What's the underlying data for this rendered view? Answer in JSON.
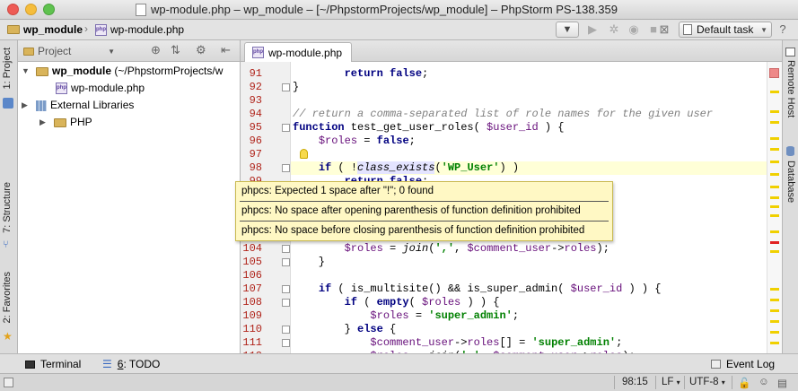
{
  "window": {
    "title": "wp-module.php – wp_module – [~/PhpstormProjects/wp_module] – PhpStorm PS-138.359"
  },
  "navbar": {
    "crumb_project": "wp_module",
    "crumb_file": "wp-module.php",
    "run_config": "Default task"
  },
  "left_strip": {
    "project_tab": "1: Project",
    "structure_tab": "7: Structure",
    "favorites_tab": "2: Favorites"
  },
  "right_strip": {
    "remote_host_tab": "Remote Host",
    "database_tab": "Database"
  },
  "project_panel": {
    "view_label": "Project",
    "tree": [
      {
        "label": "wp_module (~/PhpstormProjects/w",
        "bold_part": "wp_module",
        "rest": " (~/PhpstormProjects/w"
      },
      {
        "label": "wp-module.php"
      },
      {
        "label": "External Libraries"
      },
      {
        "label": "PHP"
      }
    ]
  },
  "editor": {
    "tab_label": "wp-module.php",
    "line_numbers": [
      "91",
      "92",
      "93",
      "94",
      "95",
      "96",
      "97",
      "98",
      "99",
      "100",
      "101",
      "102",
      "103",
      "104",
      "105",
      "106",
      "107",
      "108",
      "109",
      "110",
      "111",
      "112"
    ],
    "lines": [
      {
        "num": "91",
        "parts": [
          [
            "",
            "        "
          ],
          [
            "kw",
            "return"
          ],
          [
            "",
            " "
          ],
          [
            "kw",
            "false"
          ],
          [
            "",
            ";"
          ]
        ]
      },
      {
        "num": "92",
        "parts": [
          [
            "",
            "}"
          ]
        ]
      },
      {
        "num": "93",
        "parts": []
      },
      {
        "num": "94",
        "parts": [
          [
            "cmt",
            "// return a comma-separated list of role names for the given user"
          ]
        ]
      },
      {
        "num": "95",
        "parts": [
          [
            "kw",
            "function"
          ],
          [
            "",
            " test_get_user_roles( "
          ],
          [
            "var",
            "$user_id"
          ],
          [
            "",
            " ) {"
          ]
        ]
      },
      {
        "num": "96",
        "parts": [
          [
            "",
            "    "
          ],
          [
            "var",
            "$roles"
          ],
          [
            "",
            " = "
          ],
          [
            "kw",
            "false"
          ],
          [
            "",
            ";"
          ]
        ]
      },
      {
        "num": "97",
        "parts": []
      },
      {
        "num": "98",
        "parts": [
          [
            "",
            "    "
          ],
          [
            "kw",
            "if"
          ],
          [
            "",
            " ( !"
          ],
          [
            "fnc",
            "class_exists"
          ],
          [
            "",
            "("
          ],
          [
            "str",
            "'WP_User'"
          ],
          [
            "",
            ") )"
          ]
        ]
      },
      {
        "num": "99",
        "parts": [
          [
            "",
            "        "
          ],
          [
            "kw",
            "return"
          ],
          [
            "",
            " "
          ],
          [
            "kw",
            "false"
          ],
          [
            "",
            ";"
          ]
        ]
      },
      {
        "num": "100",
        "parts": []
      },
      {
        "num": "101",
        "parts": []
      },
      {
        "num": "102",
        "parts": []
      },
      {
        "num": "103",
        "parts": []
      },
      {
        "num": "104",
        "parts": [
          [
            "",
            "        "
          ],
          [
            "var",
            "$roles"
          ],
          [
            "",
            " = "
          ],
          [
            "fnc",
            "join"
          ],
          [
            "",
            "("
          ],
          [
            "str",
            "','"
          ],
          [
            "",
            ", "
          ],
          [
            "var",
            "$comment_user"
          ],
          [
            "",
            "->"
          ],
          [
            "var",
            "roles"
          ],
          [
            "",
            ");"
          ]
        ]
      },
      {
        "num": "105",
        "parts": [
          [
            "",
            "    }"
          ]
        ]
      },
      {
        "num": "106",
        "parts": []
      },
      {
        "num": "107",
        "parts": [
          [
            "",
            "    "
          ],
          [
            "kw",
            "if"
          ],
          [
            "",
            " ( is_multisite() && is_super_admin( "
          ],
          [
            "var",
            "$user_id"
          ],
          [
            "",
            " ) ) {"
          ]
        ]
      },
      {
        "num": "108",
        "parts": [
          [
            "",
            "        "
          ],
          [
            "kw",
            "if"
          ],
          [
            "",
            " ( "
          ],
          [
            "kw",
            "empty"
          ],
          [
            "",
            "( "
          ],
          [
            "var",
            "$roles"
          ],
          [
            "",
            " ) ) {"
          ]
        ]
      },
      {
        "num": "109",
        "parts": [
          [
            "",
            "            "
          ],
          [
            "var",
            "$roles"
          ],
          [
            "",
            " = "
          ],
          [
            "str",
            "'super_admin'"
          ],
          [
            "",
            ";"
          ]
        ]
      },
      {
        "num": "110",
        "parts": [
          [
            "",
            "        } "
          ],
          [
            "kw",
            "else"
          ],
          [
            "",
            " {"
          ]
        ]
      },
      {
        "num": "111",
        "parts": [
          [
            "",
            "            "
          ],
          [
            "var",
            "$comment_user"
          ],
          [
            "",
            "->"
          ],
          [
            "var",
            "roles"
          ],
          [
            "",
            "[] = "
          ],
          [
            "str",
            "'super_admin'"
          ],
          [
            "",
            ";"
          ]
        ]
      },
      {
        "num": "112",
        "parts": [
          [
            "",
            "            "
          ],
          [
            "var",
            "$roles"
          ],
          [
            "",
            " = "
          ],
          [
            "fnc",
            "join"
          ],
          [
            "",
            "("
          ],
          [
            "str",
            "','"
          ],
          [
            "",
            ", "
          ],
          [
            "var",
            "$comment_user"
          ],
          [
            "",
            "->"
          ],
          [
            "var",
            "roles"
          ],
          [
            "",
            ");"
          ]
        ]
      }
    ]
  },
  "tooltip": {
    "messages": [
      "phpcs: Expected 1 space after \"!\"; 0 found",
      "phpcs: No space after opening parenthesis of function definition prohibited",
      "phpcs: No space before closing parenthesis of function definition prohibited"
    ]
  },
  "bottom_bar": {
    "terminal": "Terminal",
    "todo_num": "6",
    "todo": ": TODO",
    "event_log": "Event Log"
  },
  "status_bar": {
    "position": "98:15",
    "line_sep": "LF",
    "encoding": "UTF-8"
  },
  "colors": {
    "line_number": "#b0241b",
    "keyword": "#000080",
    "string": "#008000",
    "variable": "#660e7a",
    "tooltip_bg": "#fff8c4"
  }
}
